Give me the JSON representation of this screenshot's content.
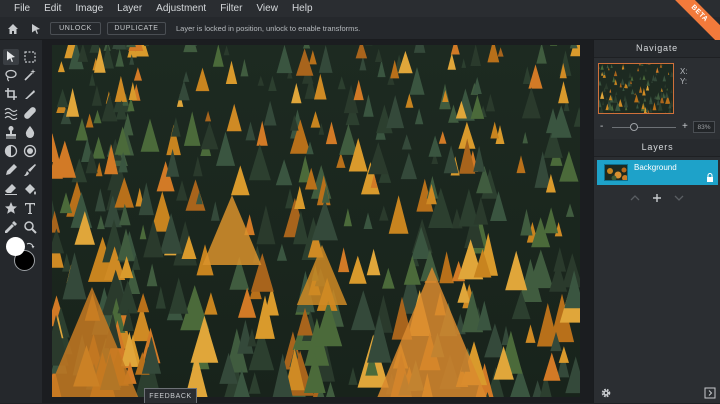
{
  "menu": [
    "File",
    "Edit",
    "Image",
    "Layer",
    "Adjustment",
    "Filter",
    "View",
    "Help"
  ],
  "options_bar": {
    "unlock_label": "UNLOCK",
    "duplicate_label": "DUPLICATE",
    "message": "Layer is locked in position, unlock to enable transforms."
  },
  "badge": "BETA",
  "navigate": {
    "title": "Navigate",
    "x_label": "X:",
    "y_label": "Y:",
    "zoom_minus": "-",
    "zoom_plus": "+",
    "zoom_value": "83%",
    "zoom_level": 0.35
  },
  "layers": {
    "title": "Layers",
    "items": [
      {
        "name": "Background",
        "locked": true
      }
    ]
  },
  "feedback_label": "FEEDBACK",
  "colors": {
    "accent": "#1ea2c9",
    "beta": "#f27a3b",
    "primary_color": "#ffffff",
    "secondary_color": "#000000"
  },
  "tools": [
    "move-tool",
    "marquee-tool",
    "lasso-tool",
    "magic-wand-tool",
    "crop-tool",
    "slice-tool",
    "liquify-tool",
    "heal-tool",
    "stamp-tool",
    "drop-tool",
    "sponge-tool",
    "focus-tool",
    "pen-tool",
    "brush-tool",
    "eraser-tool",
    "fill-tool",
    "shape-tool",
    "type-tool",
    "eyedropper-tool",
    "zoom-tool"
  ]
}
